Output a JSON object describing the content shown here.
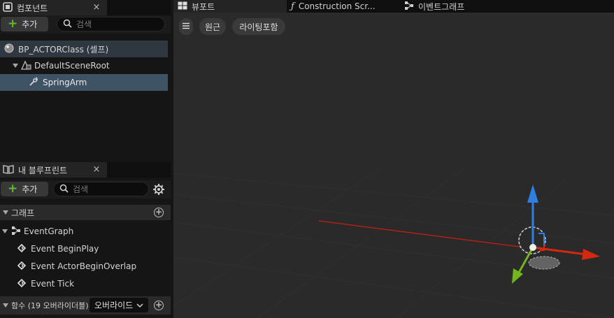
{
  "components_panel": {
    "tab_label": "컴포넌트",
    "close": "×",
    "add_label": "추가",
    "search_placeholder": "검색",
    "items": [
      {
        "label": "BP_ACTORClass (셀프)"
      },
      {
        "label": "DefaultSceneRoot"
      },
      {
        "label": "SpringArm"
      }
    ]
  },
  "blueprint_panel": {
    "tab_label": "내 블루프린트",
    "close": "×",
    "add_label": "추가",
    "search_placeholder": "검색",
    "graph_section": "그래프",
    "event_graph": "EventGraph",
    "events": [
      {
        "label": "Event BeginPlay"
      },
      {
        "label": "Event ActorBeginOverlap"
      },
      {
        "label": "Event Tick"
      }
    ],
    "functions_section": "함수 (19 오버라이더블)",
    "override_label": "오버라이드"
  },
  "editor_tabs": [
    {
      "label": "뷰포트",
      "icon": "viewport-icon"
    },
    {
      "label": "Construction Scr...",
      "icon": "function-icon"
    },
    {
      "label": "이벤트그래프",
      "icon": "event-graph-icon"
    }
  ],
  "viewport": {
    "menu_icon": "hamburger-icon",
    "perspective_label": "원근",
    "lighting_label": "라이팅포함"
  },
  "colors": {
    "accent_add": "#5fbf26",
    "selected_row": "#3e5365",
    "gizmo_x": "#d4280f",
    "gizmo_y": "#73b51c",
    "gizmo_z": "#2e7fe0"
  }
}
